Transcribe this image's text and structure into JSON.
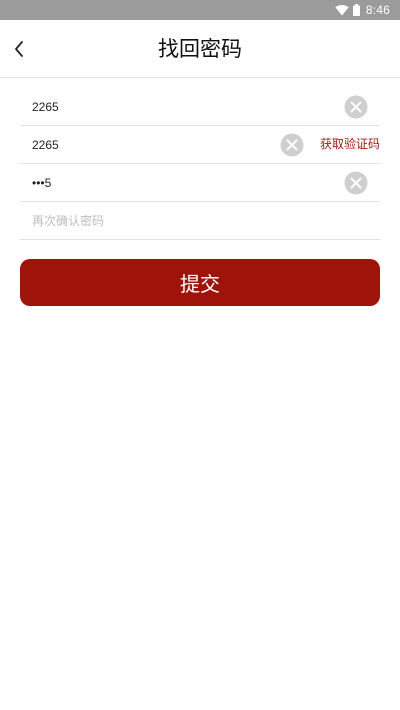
{
  "status_bar": {
    "time": "8:46",
    "wifi_icon": "wifi-icon",
    "battery_icon": "battery-icon"
  },
  "header": {
    "title": "找回密码",
    "back_icon": "chevron-left-icon"
  },
  "form": {
    "phone": {
      "value": "2265",
      "clear_icon": "clear-circle-icon"
    },
    "code": {
      "value": "2265",
      "clear_icon": "clear-circle-icon",
      "get_code_label": "获取验证码"
    },
    "password": {
      "value": "•••5",
      "clear_icon": "clear-circle-icon"
    },
    "confirm": {
      "value": "",
      "placeholder": "再次确认密码"
    }
  },
  "submit": {
    "label": "提交"
  },
  "colors": {
    "status_bar": "#9b9b9b",
    "accent": "#9e140b",
    "link": "#9e1b13",
    "clear_icon": "#cfcfcf"
  }
}
